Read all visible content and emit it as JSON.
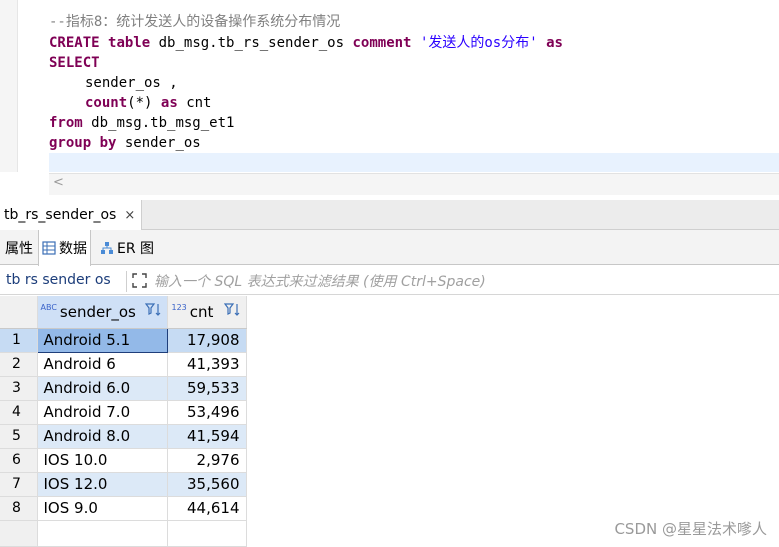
{
  "editor": {
    "comment": "--指标8：统计发送人的设备操作系统分布情况",
    "line_create_kw1": "CREATE",
    "line_create_kw2": "table",
    "line_create_name": "db_msg.tb_rs_sender_os",
    "line_create_kw3": "comment",
    "line_create_str": "'发送人的os分布'",
    "line_create_kw4": "as",
    "line_select": "SELECT",
    "line_field1": "sender_os ,",
    "line_count_fn": "count",
    "line_count_arg": "(*)",
    "line_count_as": "as",
    "line_count_alias": "cnt",
    "line_from_kw": "from",
    "line_from_table": "db_msg.tb_msg_et1",
    "line_group_kw": "group by",
    "line_group_field": "sender_os",
    "scroll_left_glyph": "<"
  },
  "result_tab": {
    "label": "tb_rs_sender_os",
    "close_glyph": "×"
  },
  "view_tabs": [
    {
      "label": "属性"
    },
    {
      "label": "数据"
    },
    {
      "label": "ER 图"
    }
  ],
  "filter": {
    "table_name": "tb rs sender os",
    "placeholder": "输入一个 SQL 表达式来过滤结果 (使用 Ctrl+Space)"
  },
  "grid": {
    "columns": [
      {
        "name": "sender_os",
        "type_badge": "ABC"
      },
      {
        "name": "cnt",
        "type_badge": "123"
      }
    ],
    "rows": [
      {
        "num": "1",
        "sender_os": "Android 5.1",
        "cnt": "17,908"
      },
      {
        "num": "2",
        "sender_os": "Android 6",
        "cnt": "41,393"
      },
      {
        "num": "3",
        "sender_os": "Android 6.0",
        "cnt": "59,533"
      },
      {
        "num": "4",
        "sender_os": "Android 7.0",
        "cnt": "53,496"
      },
      {
        "num": "5",
        "sender_os": "Android 8.0",
        "cnt": "41,594"
      },
      {
        "num": "6",
        "sender_os": "IOS 10.0",
        "cnt": "2,976"
      },
      {
        "num": "7",
        "sender_os": "IOS 12.0",
        "cnt": "35,560"
      },
      {
        "num": "8",
        "sender_os": "IOS 9.0",
        "cnt": "44,614"
      }
    ]
  },
  "watermark": "CSDN @星星法术嗲人",
  "colors": {
    "keyword": "#7f0055",
    "string": "#2a00ff",
    "comment": "#808080",
    "selected_cell": "#93b9e8",
    "alt_row": "#dce9f7",
    "header_selected": "#cfe0f6"
  }
}
